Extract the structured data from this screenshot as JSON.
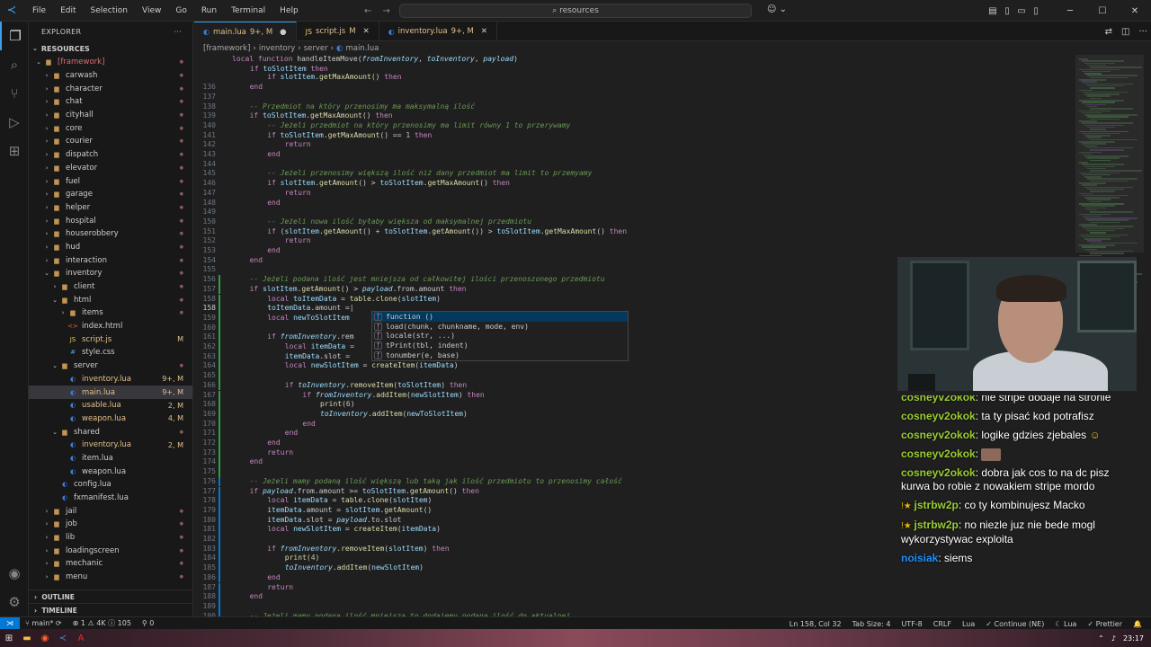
{
  "titlebar": {
    "menu": [
      "File",
      "Edit",
      "Selection",
      "View",
      "Go",
      "Run",
      "Terminal",
      "Help"
    ],
    "search": "resources"
  },
  "sidebar": {
    "title": "EXPLORER",
    "root": "RESOURCES",
    "items": [
      {
        "label": "[framework]",
        "type": "folder",
        "open": true,
        "depth": 0,
        "badge": "",
        "status": "red"
      },
      {
        "label": "carwash",
        "type": "folder",
        "open": false,
        "depth": 1,
        "badge": ""
      },
      {
        "label": "character",
        "type": "folder",
        "open": false,
        "depth": 1,
        "badge": ""
      },
      {
        "label": "chat",
        "type": "folder",
        "open": false,
        "depth": 1,
        "badge": ""
      },
      {
        "label": "cityhall",
        "type": "folder",
        "open": false,
        "depth": 1,
        "badge": ""
      },
      {
        "label": "core",
        "type": "folder",
        "open": false,
        "depth": 1,
        "badge": ""
      },
      {
        "label": "courier",
        "type": "folder",
        "open": false,
        "depth": 1,
        "badge": ""
      },
      {
        "label": "dispatch",
        "type": "folder",
        "open": false,
        "depth": 1,
        "badge": ""
      },
      {
        "label": "elevator",
        "type": "folder",
        "open": false,
        "depth": 1,
        "badge": ""
      },
      {
        "label": "fuel",
        "type": "folder",
        "open": false,
        "depth": 1,
        "badge": ""
      },
      {
        "label": "garage",
        "type": "folder",
        "open": false,
        "depth": 1,
        "badge": ""
      },
      {
        "label": "helper",
        "type": "folder",
        "open": false,
        "depth": 1,
        "badge": ""
      },
      {
        "label": "hospital",
        "type": "folder",
        "open": false,
        "depth": 1,
        "badge": ""
      },
      {
        "label": "houserobbery",
        "type": "folder",
        "open": false,
        "depth": 1,
        "badge": ""
      },
      {
        "label": "hud",
        "type": "folder",
        "open": false,
        "depth": 1,
        "badge": ""
      },
      {
        "label": "interaction",
        "type": "folder",
        "open": false,
        "depth": 1,
        "badge": ""
      },
      {
        "label": "inventory",
        "type": "folder",
        "open": true,
        "depth": 1,
        "badge": ""
      },
      {
        "label": "client",
        "type": "folder",
        "open": false,
        "depth": 2,
        "badge": ""
      },
      {
        "label": "html",
        "type": "folder",
        "open": true,
        "depth": 2,
        "badge": ""
      },
      {
        "label": "items",
        "type": "folder",
        "open": false,
        "depth": 3,
        "badge": ""
      },
      {
        "label": "index.html",
        "type": "html",
        "depth": 3,
        "badge": ""
      },
      {
        "label": "script.js",
        "type": "js",
        "depth": 3,
        "badge": "M"
      },
      {
        "label": "style.css",
        "type": "css",
        "depth": 3,
        "badge": ""
      },
      {
        "label": "server",
        "type": "folder",
        "open": true,
        "depth": 2,
        "badge": ""
      },
      {
        "label": "inventory.lua",
        "type": "lua",
        "depth": 3,
        "badge": "9+, M"
      },
      {
        "label": "main.lua",
        "type": "lua",
        "depth": 3,
        "badge": "9+, M",
        "selected": true
      },
      {
        "label": "usable.lua",
        "type": "lua",
        "depth": 3,
        "badge": "2, M"
      },
      {
        "label": "weapon.lua",
        "type": "lua",
        "depth": 3,
        "badge": "4, M"
      },
      {
        "label": "shared",
        "type": "folder",
        "open": true,
        "depth": 2,
        "badge": ""
      },
      {
        "label": "inventory.lua",
        "type": "lua",
        "depth": 3,
        "badge": "2, M"
      },
      {
        "label": "item.lua",
        "type": "lua",
        "depth": 3,
        "badge": ""
      },
      {
        "label": "weapon.lua",
        "type": "lua",
        "depth": 3,
        "badge": ""
      },
      {
        "label": "config.lua",
        "type": "lua",
        "depth": 2,
        "badge": ""
      },
      {
        "label": "fxmanifest.lua",
        "type": "lua",
        "depth": 2,
        "badge": ""
      },
      {
        "label": "jail",
        "type": "folder",
        "open": false,
        "depth": 1,
        "badge": ""
      },
      {
        "label": "job",
        "type": "folder",
        "open": false,
        "depth": 1,
        "badge": ""
      },
      {
        "label": "lib",
        "type": "folder",
        "open": false,
        "depth": 1,
        "badge": ""
      },
      {
        "label": "loadingscreen",
        "type": "folder",
        "open": false,
        "depth": 1,
        "badge": ""
      },
      {
        "label": "mechanic",
        "type": "folder",
        "open": false,
        "depth": 1,
        "badge": ""
      },
      {
        "label": "menu",
        "type": "folder",
        "open": false,
        "depth": 1,
        "badge": ""
      }
    ],
    "outline": "OUTLINE",
    "timeline": "TIMELINE"
  },
  "tabs": [
    {
      "name": "main.lua",
      "status": "9+, M",
      "active": true,
      "icon": "lua"
    },
    {
      "name": "script.js",
      "status": "M",
      "active": false,
      "icon": "js"
    },
    {
      "name": "inventory.lua",
      "status": "9+, M",
      "active": false,
      "icon": "lua"
    }
  ],
  "breadcrumb": [
    "[framework]",
    "inventory",
    "server",
    "main.lua"
  ],
  "editor": {
    "header_line": "local function handleItemMove(fromInventory, toInventory, payload)",
    "header_line2": "    if toSlotItem then",
    "lines": [
      {
        "n": "",
        "t": "        if slotItem.getMaxAmount() then"
      },
      {
        "n": "136",
        "t": "    end"
      },
      {
        "n": "137",
        "t": ""
      },
      {
        "n": "138",
        "t": "    -- Przedmiot na który przenosimy ma maksymalną ilość"
      },
      {
        "n": "139",
        "t": "    if toSlotItem.getMaxAmount() then"
      },
      {
        "n": "140",
        "t": "        -- Jeżeli przedmiot na który przenosimy ma limit równy 1 to przerywamy"
      },
      {
        "n": "141",
        "t": "        if toSlotItem.getMaxAmount() == 1 then"
      },
      {
        "n": "142",
        "t": "            return"
      },
      {
        "n": "143",
        "t": "        end"
      },
      {
        "n": "144",
        "t": ""
      },
      {
        "n": "145",
        "t": "        -- Jeżeli przenosimy większą ilość niż dany przedmiot ma limit to przemyamy"
      },
      {
        "n": "146",
        "t": "        if slotItem.getAmount() > toSlotItem.getMaxAmount() then"
      },
      {
        "n": "147",
        "t": "            return"
      },
      {
        "n": "148",
        "t": "        end"
      },
      {
        "n": "149",
        "t": ""
      },
      {
        "n": "150",
        "t": "        -- Jeżeli nowa ilość byłaby większa od maksymalnej przedmiotu"
      },
      {
        "n": "151",
        "t": "        if (slotItem.getAmount() + toSlotItem.getAmount()) > toSlotItem.getMaxAmount() then"
      },
      {
        "n": "152",
        "t": "            return"
      },
      {
        "n": "153",
        "t": "        end"
      },
      {
        "n": "154",
        "t": "    end"
      },
      {
        "n": "155",
        "t": ""
      },
      {
        "n": "156",
        "t": "    -- Jeżeli podana ilość jest mniejsza od całkowitej ilości przenoszonego przedmiotu"
      },
      {
        "n": "157",
        "t": "    if slotItem.getAmount() > payload.from.amount then"
      },
      {
        "n": "158",
        "t": "        local toItemData = table.clone(slotItem)"
      },
      {
        "n": "158",
        "t": "        toItemData.amount = |",
        "cur": true
      },
      {
        "n": "159",
        "t": "        local newToSlotItem"
      },
      {
        "n": "160",
        "t": ""
      },
      {
        "n": "161",
        "t": "        if fromInventory.rem"
      },
      {
        "n": "162",
        "t": "            local itemData ="
      },
      {
        "n": "163",
        "t": "            itemData.slot ="
      },
      {
        "n": "164",
        "t": "            local newSlotItem = createItem(itemData)"
      },
      {
        "n": "165",
        "t": ""
      },
      {
        "n": "166",
        "t": "            if toInventory.removeItem(toSlotItem) then"
      },
      {
        "n": "167",
        "t": "                if fromInventory.addItem(newSlotItem) then"
      },
      {
        "n": "168",
        "t": "                    print(6)"
      },
      {
        "n": "169",
        "t": "                    toInventory.addItem(newToSlotItem)"
      },
      {
        "n": "170",
        "t": "                end"
      },
      {
        "n": "171",
        "t": "            end"
      },
      {
        "n": "172",
        "t": "        end"
      },
      {
        "n": "173",
        "t": "        return"
      },
      {
        "n": "174",
        "t": "    end"
      },
      {
        "n": "175",
        "t": ""
      },
      {
        "n": "176",
        "t": "    -- Jeżeli mamy podaną ilość większą lub taką jak ilość przedmiotu to przenosimy całość"
      },
      {
        "n": "177",
        "t": "    if payload.from.amount >= toSlotItem.getAmount() then"
      },
      {
        "n": "178",
        "t": "        local itemData = table.clone(slotItem)"
      },
      {
        "n": "179",
        "t": "        itemData.amount = slotItem.getAmount()"
      },
      {
        "n": "180",
        "t": "        itemData.slot = payload.to.slot"
      },
      {
        "n": "181",
        "t": "        local newSlotItem = createItem(itemData)"
      },
      {
        "n": "182",
        "t": ""
      },
      {
        "n": "183",
        "t": "        if fromInventory.removeItem(slotItem) then"
      },
      {
        "n": "184",
        "t": "            print(4)"
      },
      {
        "n": "185",
        "t": "            toInventory.addItem(newSlotItem)"
      },
      {
        "n": "186",
        "t": "        end"
      },
      {
        "n": "187",
        "t": "        return"
      },
      {
        "n": "188",
        "t": "    end"
      },
      {
        "n": "189",
        "t": ""
      },
      {
        "n": "190",
        "t": "    -- Jeżeli mamy podaną ilość mniejszą to dodajemy podaną ilość do aktualnej"
      }
    ]
  },
  "suggest": [
    "function ()",
    "load(chunk, chunkname, mode, env)",
    "locale(str, ...)",
    "tPrint(tbl, indent)",
    "tonumber(e, base)"
  ],
  "chat": [
    {
      "user": "cosneyv2okok",
      "text": "nie stripe dodaje na stronie",
      "color": "#9acd32",
      "badges": ""
    },
    {
      "user": "cosneyv2okok",
      "text": "ta ty pisać kod potrafisz",
      "color": "#9acd32",
      "badges": ""
    },
    {
      "user": "cosneyv2okok",
      "text": "logike gdzies zjebales",
      "color": "#9acd32",
      "badges": "",
      "emote_after": true
    },
    {
      "user": "cosneyv2okok",
      "text": "",
      "color": "#9acd32",
      "badges": "",
      "emote_only": true
    },
    {
      "user": "cosneyv2okok",
      "text": "dobra jak cos to na dc pisz kurwa bo robie z nowakiem stripe mordo",
      "color": "#9acd32",
      "badges": ""
    },
    {
      "user": "jstrbw2p",
      "text": "co ty kombinujesz Macko",
      "color": "#9acd32",
      "badges": "!★"
    },
    {
      "user": "jstrbw2p",
      "text": "no niezle juz nie bede mogl wykorzystywac exploita",
      "color": "#9acd32",
      "badges": "!★"
    },
    {
      "user": "noisiak",
      "text": "siems",
      "color": "#1e90ff",
      "badges": ""
    }
  ],
  "status": {
    "branch": "main*",
    "sync": "⟳",
    "problems": "⊗ 1",
    "warnings": "⚠ 4K",
    "info": "ⓘ 105",
    "ports": "⚲ 0",
    "position": "Ln 158, Col 32",
    "tabsize": "Tab Size: 4",
    "encoding": "UTF-8",
    "eol": "CRLF",
    "lang": "Lua",
    "continue": "Continue (NE)",
    "lua": "Lua",
    "prettier": "Prettier"
  },
  "taskbar": {
    "time": "23:17"
  }
}
